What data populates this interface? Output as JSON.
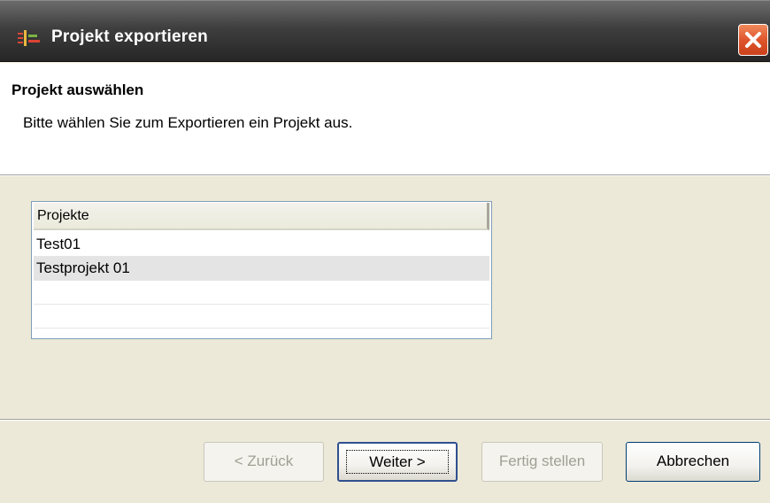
{
  "window": {
    "title": "Projekt exportieren",
    "close_icon": "close-icon"
  },
  "header": {
    "title": "Projekt auswählen",
    "description": "Bitte wählen Sie zum Exportieren ein Projekt aus."
  },
  "table": {
    "column_header": "Projekte",
    "rows": [
      "Test01",
      "Testprojekt 01",
      "",
      ""
    ]
  },
  "buttons": {
    "back": "< Zurück",
    "next": "Weiter >",
    "finish": "Fertig stellen",
    "cancel": "Abbrechen"
  },
  "colors": {
    "titlebar": "#3e3e3e",
    "close_button": "#e0552c",
    "dialog_background": "#ece9d8"
  }
}
